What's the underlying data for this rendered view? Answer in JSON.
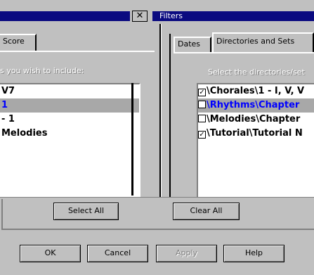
{
  "left_window": {
    "close_glyph": "✕",
    "tab_label": "Score",
    "instruction": "s you wish to include:",
    "list_items": [
      {
        "text": "V7",
        "selected": false
      },
      {
        "text": "1",
        "selected": true
      },
      {
        "text": "- 1",
        "selected": false
      },
      {
        "text": "Melodies",
        "selected": false
      }
    ]
  },
  "right_window": {
    "title": "Filters",
    "tabs": [
      {
        "label": "Dates",
        "active": false
      },
      {
        "label": "Directories and Sets",
        "active": true
      }
    ],
    "instruction": "Select the directories/set",
    "items": [
      {
        "text": "\\Chorales\\1 - I, V, V",
        "checked": true,
        "color": "#000000"
      },
      {
        "text": "\\Rhythms\\Chapter",
        "checked": false,
        "color": "#0000ff"
      },
      {
        "text": "\\Melodies\\Chapter",
        "checked": false,
        "color": "#000000"
      },
      {
        "text": "\\Tutorial\\Tutorial N",
        "checked": true,
        "color": "#000000"
      }
    ],
    "select_all_label": "Select All",
    "clear_all_label": "Clear All"
  },
  "dialog_buttons": {
    "ok": "OK",
    "cancel": "Cancel",
    "apply": "Apply",
    "help": "Help"
  },
  "colors": {
    "titlebar": "#0a0a80",
    "face": "#c0c0c0",
    "selection": "#a8a8a8",
    "highlight_text": "#0000ff"
  }
}
